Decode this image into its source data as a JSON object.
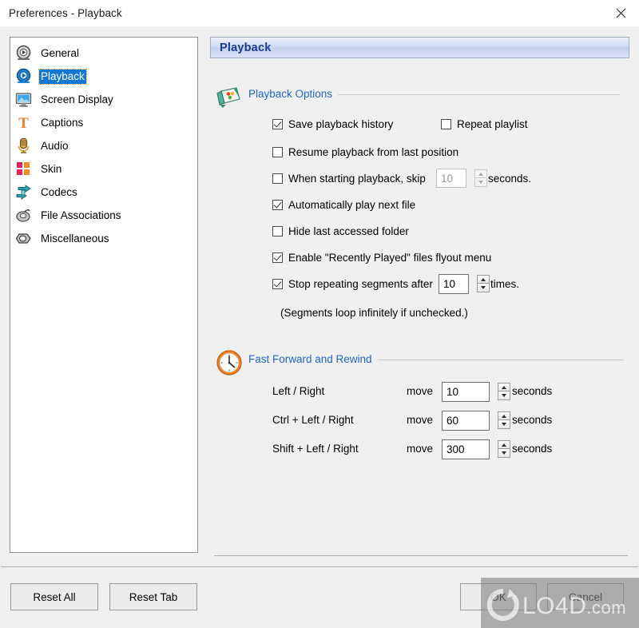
{
  "window": {
    "title": "Preferences - Playback",
    "close_icon": "close-icon"
  },
  "sidebar": {
    "items": [
      {
        "label": "General",
        "icon": "play-circle-grey-icon",
        "selected": false
      },
      {
        "label": "Playback",
        "icon": "play-circle-blue-icon",
        "selected": true
      },
      {
        "label": "Screen Display",
        "icon": "monitor-icon",
        "selected": false
      },
      {
        "label": "Captions",
        "icon": "text-t-icon",
        "selected": false
      },
      {
        "label": "Audio",
        "icon": "microphone-icon",
        "selected": false
      },
      {
        "label": "Skin",
        "icon": "squares-icon",
        "selected": false
      },
      {
        "label": "Codecs",
        "icon": "arrows-icon",
        "selected": false
      },
      {
        "label": "File Associations",
        "icon": "file-link-icon",
        "selected": false
      },
      {
        "label": "Miscellaneous",
        "icon": "nut-icon",
        "selected": false
      }
    ]
  },
  "panel": {
    "header_title": "Playback",
    "playback_options": {
      "title": "Playback Options",
      "icon": "card-dots-icon",
      "checkboxes": [
        {
          "label": "Save playback history",
          "checked": true
        },
        {
          "label": "Repeat playlist",
          "checked": false
        },
        {
          "label": "Resume playback from last position",
          "checked": false
        },
        {
          "label": "When starting playback, skip",
          "checked": false
        },
        {
          "label": "Automatically play next file",
          "checked": true
        },
        {
          "label": "Hide last accessed folder",
          "checked": false
        },
        {
          "label": "Enable \"Recently Played\" files flyout menu",
          "checked": true
        },
        {
          "label": "Stop repeating segments after",
          "checked": true
        }
      ],
      "skip_value": "10",
      "skip_units": "seconds.",
      "skip_enabled": false,
      "repeat_value": "10",
      "repeat_units": "times.",
      "repeat_enabled": true,
      "note": "(Segments loop infinitely if unchecked.)"
    },
    "fast_forward": {
      "title": "Fast Forward and Rewind",
      "icon": "clock-icon",
      "move_label": "move",
      "units_label": "seconds",
      "rows": [
        {
          "label": "Left / Right",
          "value": "10"
        },
        {
          "label": "Ctrl + Left / Right",
          "value": "60"
        },
        {
          "label": "Shift + Left / Right",
          "value": "300"
        }
      ]
    }
  },
  "footer": {
    "reset_all": "Reset All",
    "reset_tab": "Reset Tab",
    "ok": "OK",
    "cancel": "Cancel"
  },
  "watermark": {
    "text": "LO4D",
    "suffix": ".com"
  },
  "colors": {
    "accent_blue": "#2264c4",
    "selection_blue": "#1478d2",
    "header_title": "#1a3a8f",
    "dialog_bg": "#f0f0f0"
  }
}
